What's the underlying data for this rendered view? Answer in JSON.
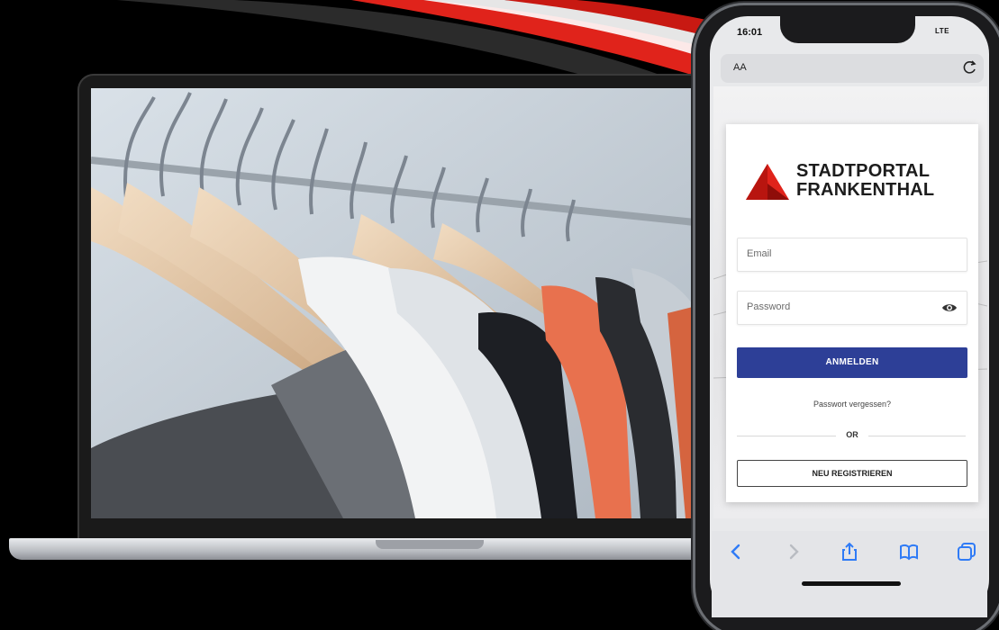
{
  "phone": {
    "status_time": "16:01",
    "status_right": "LTE",
    "address_bar": {
      "aa_label": "AA"
    },
    "logo": {
      "line1": "STADTPORTAL",
      "line2": "FRANKENTHAL"
    },
    "form": {
      "email_placeholder": "Email",
      "password_placeholder": "Password",
      "login_button": "ANMELDEN",
      "forgot_link": "Passwort vergessen?",
      "divider_text": "OR",
      "register_button": "NEU REGISTRIEREN"
    },
    "toolbar": {
      "icons": [
        "chevron-left-icon",
        "chevron-right-icon",
        "share-icon",
        "bookmarks-icon",
        "tabs-icon"
      ]
    }
  },
  "laptop": {
    "screen_image": "clothes-on-hangers-photo"
  },
  "colors": {
    "primary_blue": "#2d3f97",
    "logo_red": "#e0231b",
    "accent_blue": "#2f7bf6"
  }
}
